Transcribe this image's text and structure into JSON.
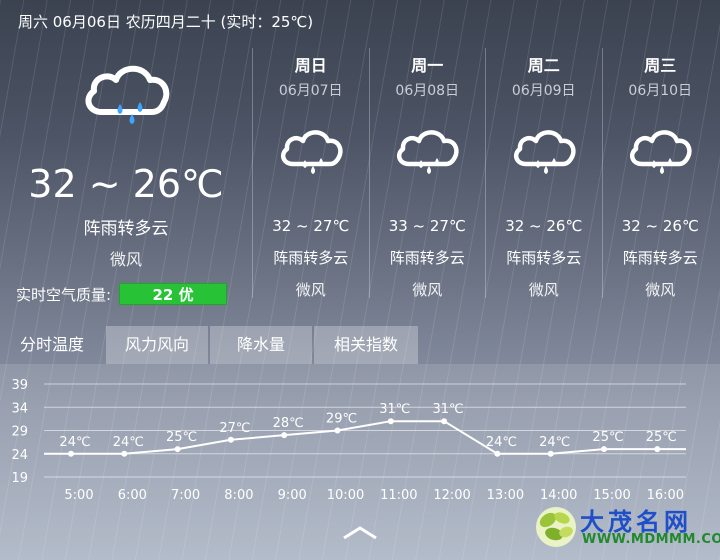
{
  "header": {
    "date_text": "周六 06月06日 农历四月二十 (实时：25℃)"
  },
  "today": {
    "icon": "cloud-rain-icon",
    "temp": "32 ~ 26℃",
    "desc": "阵雨转多云",
    "wind": "微风",
    "aqi_label": "实时空气质量:",
    "aqi_value": "22 优",
    "aqi_color": "#28c236"
  },
  "forecast": [
    {
      "day": "周日",
      "date": "06月07日",
      "icon": "cloud-rain-icon",
      "temp": "32 ~ 27℃",
      "desc": "阵雨转多云",
      "wind": "微风"
    },
    {
      "day": "周一",
      "date": "06月08日",
      "icon": "cloud-rain-icon",
      "temp": "33 ~ 27℃",
      "desc": "阵雨转多云",
      "wind": "微风"
    },
    {
      "day": "周二",
      "date": "06月09日",
      "icon": "cloud-rain-icon",
      "temp": "32 ~ 26℃",
      "desc": "阵雨转多云",
      "wind": "微风"
    },
    {
      "day": "周三",
      "date": "06月10日",
      "icon": "cloud-rain-icon",
      "temp": "32 ~ 26℃",
      "desc": "阵雨转多云",
      "wind": "微风"
    }
  ],
  "tabs": [
    {
      "label": "分时温度",
      "active": true
    },
    {
      "label": "风力风向",
      "active": false
    },
    {
      "label": "降水量",
      "active": false
    },
    {
      "label": "相关指数",
      "active": false
    }
  ],
  "chart_data": {
    "type": "line",
    "title": "",
    "xlabel": "",
    "ylabel": "",
    "categories": [
      "5:00",
      "6:00",
      "7:00",
      "8:00",
      "9:00",
      "10:00",
      "11:00",
      "12:00",
      "13:00",
      "14:00",
      "15:00",
      "16:00"
    ],
    "values": [
      24,
      24,
      25,
      27,
      28,
      29,
      31,
      31,
      24,
      24,
      25,
      25
    ],
    "point_labels": [
      "24℃",
      "24℃",
      "25℃",
      "27℃",
      "28℃",
      "29℃",
      "31℃",
      "31℃",
      "24℃",
      "24℃",
      "25℃",
      "25℃"
    ],
    "yticks": [
      39,
      34,
      29,
      24,
      19
    ],
    "ylim": [
      19,
      39
    ],
    "grid": true,
    "legend": "none"
  },
  "collapse_icon": "chevron-up-icon",
  "watermark": {
    "name": "大茂名网",
    "url": "WWW.MDMMM.COM"
  }
}
